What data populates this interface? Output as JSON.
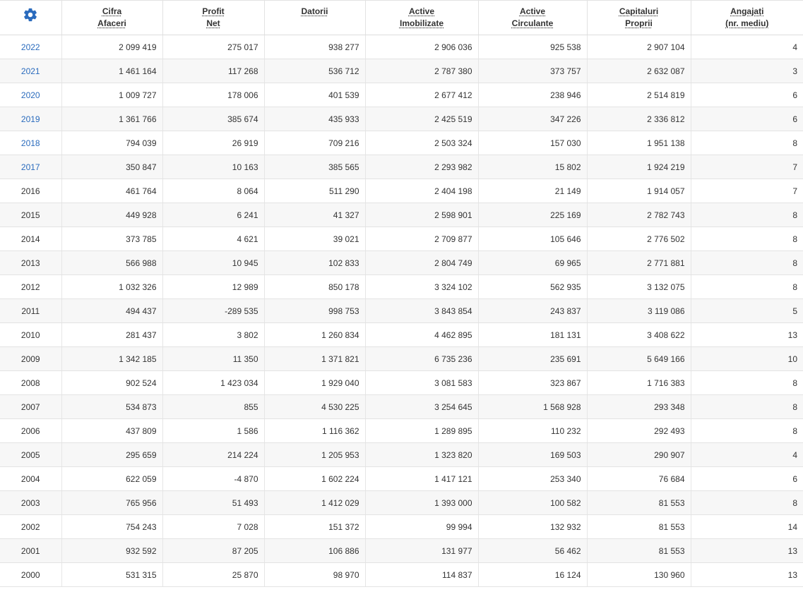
{
  "header": {
    "settings_icon": "gear-icon",
    "columns": [
      {
        "line1": "Cifra",
        "line2": "Afaceri"
      },
      {
        "line1": "Profit",
        "line2": "Net"
      },
      {
        "line1": "Datorii",
        "line2": ""
      },
      {
        "line1": "Active",
        "line2": "Imobilizate"
      },
      {
        "line1": "Active",
        "line2": "Circulante"
      },
      {
        "line1": "Capitaluri",
        "line2": "Proprii"
      },
      {
        "line1": "Angajați",
        "line2": "(nr. mediu)"
      }
    ]
  },
  "colors": {
    "link_year": "#2a6bbd",
    "gear_icon": "#2a6bbd",
    "row_alt_bg": "#f7f7f7"
  },
  "rows": [
    {
      "year": "2022",
      "year_is_link": true,
      "cifra_afaceri": "2 099 419",
      "profit_net": "275 017",
      "datorii": "938 277",
      "active_imobilizate": "2 906 036",
      "active_circulante": "925 538",
      "capitaluri_proprii": "2 907 104",
      "angajati": "4"
    },
    {
      "year": "2021",
      "year_is_link": true,
      "cifra_afaceri": "1 461 164",
      "profit_net": "117 268",
      "datorii": "536 712",
      "active_imobilizate": "2 787 380",
      "active_circulante": "373 757",
      "capitaluri_proprii": "2 632 087",
      "angajati": "3"
    },
    {
      "year": "2020",
      "year_is_link": true,
      "cifra_afaceri": "1 009 727",
      "profit_net": "178 006",
      "datorii": "401 539",
      "active_imobilizate": "2 677 412",
      "active_circulante": "238 946",
      "capitaluri_proprii": "2 514 819",
      "angajati": "6"
    },
    {
      "year": "2019",
      "year_is_link": true,
      "cifra_afaceri": "1 361 766",
      "profit_net": "385 674",
      "datorii": "435 933",
      "active_imobilizate": "2 425 519",
      "active_circulante": "347 226",
      "capitaluri_proprii": "2 336 812",
      "angajati": "6"
    },
    {
      "year": "2018",
      "year_is_link": true,
      "cifra_afaceri": "794 039",
      "profit_net": "26 919",
      "datorii": "709 216",
      "active_imobilizate": "2 503 324",
      "active_circulante": "157 030",
      "capitaluri_proprii": "1 951 138",
      "angajati": "8"
    },
    {
      "year": "2017",
      "year_is_link": true,
      "cifra_afaceri": "350 847",
      "profit_net": "10 163",
      "datorii": "385 565",
      "active_imobilizate": "2 293 982",
      "active_circulante": "15 802",
      "capitaluri_proprii": "1 924 219",
      "angajati": "7"
    },
    {
      "year": "2016",
      "year_is_link": false,
      "cifra_afaceri": "461 764",
      "profit_net": "8 064",
      "datorii": "511 290",
      "active_imobilizate": "2 404 198",
      "active_circulante": "21 149",
      "capitaluri_proprii": "1 914 057",
      "angajati": "7"
    },
    {
      "year": "2015",
      "year_is_link": false,
      "cifra_afaceri": "449 928",
      "profit_net": "6 241",
      "datorii": "41 327",
      "active_imobilizate": "2 598 901",
      "active_circulante": "225 169",
      "capitaluri_proprii": "2 782 743",
      "angajati": "8"
    },
    {
      "year": "2014",
      "year_is_link": false,
      "cifra_afaceri": "373 785",
      "profit_net": "4 621",
      "datorii": "39 021",
      "active_imobilizate": "2 709 877",
      "active_circulante": "105 646",
      "capitaluri_proprii": "2 776 502",
      "angajati": "8"
    },
    {
      "year": "2013",
      "year_is_link": false,
      "cifra_afaceri": "566 988",
      "profit_net": "10 945",
      "datorii": "102 833",
      "active_imobilizate": "2 804 749",
      "active_circulante": "69 965",
      "capitaluri_proprii": "2 771 881",
      "angajati": "8"
    },
    {
      "year": "2012",
      "year_is_link": false,
      "cifra_afaceri": "1 032 326",
      "profit_net": "12 989",
      "datorii": "850 178",
      "active_imobilizate": "3 324 102",
      "active_circulante": "562 935",
      "capitaluri_proprii": "3 132 075",
      "angajati": "8"
    },
    {
      "year": "2011",
      "year_is_link": false,
      "cifra_afaceri": "494 437",
      "profit_net": "-289 535",
      "datorii": "998 753",
      "active_imobilizate": "3 843 854",
      "active_circulante": "243 837",
      "capitaluri_proprii": "3 119 086",
      "angajati": "5"
    },
    {
      "year": "2010",
      "year_is_link": false,
      "cifra_afaceri": "281 437",
      "profit_net": "3 802",
      "datorii": "1 260 834",
      "active_imobilizate": "4 462 895",
      "active_circulante": "181 131",
      "capitaluri_proprii": "3 408 622",
      "angajati": "13"
    },
    {
      "year": "2009",
      "year_is_link": false,
      "cifra_afaceri": "1 342 185",
      "profit_net": "11 350",
      "datorii": "1 371 821",
      "active_imobilizate": "6 735 236",
      "active_circulante": "235 691",
      "capitaluri_proprii": "5 649 166",
      "angajati": "10"
    },
    {
      "year": "2008",
      "year_is_link": false,
      "cifra_afaceri": "902 524",
      "profit_net": "1 423 034",
      "datorii": "1 929 040",
      "active_imobilizate": "3 081 583",
      "active_circulante": "323 867",
      "capitaluri_proprii": "1 716 383",
      "angajati": "8"
    },
    {
      "year": "2007",
      "year_is_link": false,
      "cifra_afaceri": "534 873",
      "profit_net": "855",
      "datorii": "4 530 225",
      "active_imobilizate": "3 254 645",
      "active_circulante": "1 568 928",
      "capitaluri_proprii": "293 348",
      "angajati": "8"
    },
    {
      "year": "2006",
      "year_is_link": false,
      "cifra_afaceri": "437 809",
      "profit_net": "1 586",
      "datorii": "1 116 362",
      "active_imobilizate": "1 289 895",
      "active_circulante": "110 232",
      "capitaluri_proprii": "292 493",
      "angajati": "8"
    },
    {
      "year": "2005",
      "year_is_link": false,
      "cifra_afaceri": "295 659",
      "profit_net": "214 224",
      "datorii": "1 205 953",
      "active_imobilizate": "1 323 820",
      "active_circulante": "169 503",
      "capitaluri_proprii": "290 907",
      "angajati": "4"
    },
    {
      "year": "2004",
      "year_is_link": false,
      "cifra_afaceri": "622 059",
      "profit_net": "-4 870",
      "datorii": "1 602 224",
      "active_imobilizate": "1 417 121",
      "active_circulante": "253 340",
      "capitaluri_proprii": "76 684",
      "angajati": "6"
    },
    {
      "year": "2003",
      "year_is_link": false,
      "cifra_afaceri": "765 956",
      "profit_net": "51 493",
      "datorii": "1 412 029",
      "active_imobilizate": "1 393 000",
      "active_circulante": "100 582",
      "capitaluri_proprii": "81 553",
      "angajati": "8"
    },
    {
      "year": "2002",
      "year_is_link": false,
      "cifra_afaceri": "754 243",
      "profit_net": "7 028",
      "datorii": "151 372",
      "active_imobilizate": "99 994",
      "active_circulante": "132 932",
      "capitaluri_proprii": "81 553",
      "angajati": "14"
    },
    {
      "year": "2001",
      "year_is_link": false,
      "cifra_afaceri": "932 592",
      "profit_net": "87 205",
      "datorii": "106 886",
      "active_imobilizate": "131 977",
      "active_circulante": "56 462",
      "capitaluri_proprii": "81 553",
      "angajati": "13"
    },
    {
      "year": "2000",
      "year_is_link": false,
      "cifra_afaceri": "531 315",
      "profit_net": "25 870",
      "datorii": "98 970",
      "active_imobilizate": "114 837",
      "active_circulante": "16 124",
      "capitaluri_proprii": "130 960",
      "angajati": "13"
    }
  ]
}
